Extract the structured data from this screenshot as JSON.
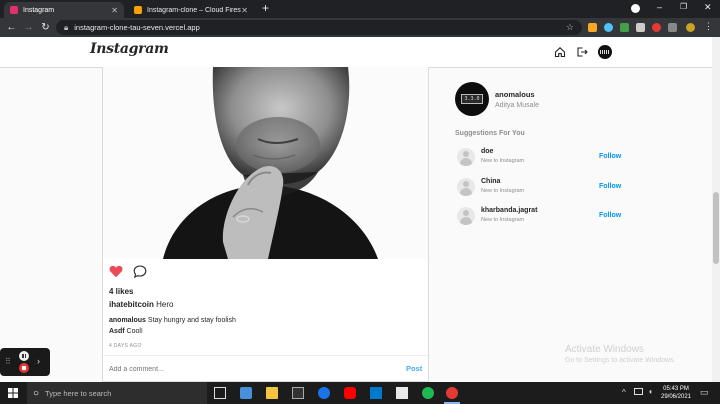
{
  "browser": {
    "tabs": [
      {
        "label": "Instagram",
        "active": true,
        "favicon_color": "#e1306c"
      },
      {
        "label": "Instagram-clone – Cloud Firesto",
        "active": false,
        "favicon_color": "#ffa000"
      }
    ],
    "new_tab": "+",
    "url": "instagram-clone-tau-seven.vercel.app"
  },
  "header": {
    "logo": "Instagram",
    "icons": [
      "home-icon",
      "logout-icon",
      "avatar"
    ]
  },
  "post": {
    "likes": "4 likes",
    "caption_user": "ihatebitcoin",
    "caption_text": "Hero",
    "comments": [
      {
        "user": "anomalous",
        "text": "Stay hungry and stay foolish"
      },
      {
        "user": "Asdf",
        "text": "Cool"
      }
    ],
    "time": "4 DAYS AGO",
    "comment_placeholder": "Add a comment...",
    "post_button": "Post",
    "liked": true
  },
  "sidebar": {
    "username": "anomalous",
    "fullname": "Aditya Musale",
    "avatar_text": "3.3.0",
    "suggestions_title": "Suggestions For You",
    "suggestions": [
      {
        "name": "doe",
        "sub": "New to Instagram",
        "action": "Follow"
      },
      {
        "name": "China",
        "sub": "New to Instagram",
        "action": "Follow"
      },
      {
        "name": "kharbanda.jagrat",
        "sub": "New to Instagram",
        "action": "Follow"
      }
    ]
  },
  "watermark": {
    "title": "Activate Windows",
    "sub": "Go to Settings to activate Windows."
  },
  "taskbar": {
    "search_placeholder": "Type here to search",
    "time": "05:43 PM",
    "date": "29/06/2021"
  },
  "colors": {
    "accent": "#0095f6",
    "heart": "#ed4956"
  }
}
